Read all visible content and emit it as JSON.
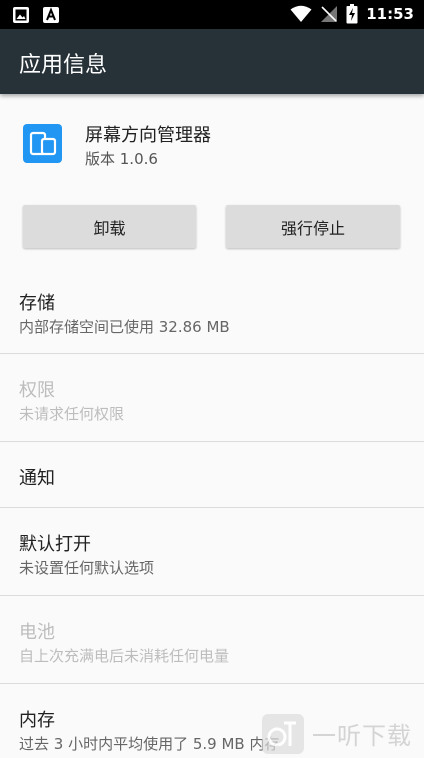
{
  "status_bar": {
    "time": "11:53",
    "left_icons": [
      "image-icon",
      "text-icon"
    ],
    "right_icons": [
      "wifi-icon",
      "signal-off-icon",
      "battery-charging-icon"
    ]
  },
  "app_bar": {
    "title": "应用信息"
  },
  "app": {
    "name": "屏幕方向管理器",
    "version": "版本 1.0.6",
    "icon_color": "#2196f3"
  },
  "buttons": {
    "uninstall": "卸载",
    "force_stop": "强行停止"
  },
  "prefs": [
    {
      "title": "存储",
      "subtitle": "内部存储空间已使用 32.86 MB",
      "enabled": true
    },
    {
      "title": "权限",
      "subtitle": "未请求任何权限",
      "enabled": false
    },
    {
      "title": "通知",
      "enabled": true
    },
    {
      "title": "默认打开",
      "subtitle": "未设置任何默认选项",
      "enabled": true
    },
    {
      "title": "电池",
      "subtitle": "自上次充满电后未消耗任何电量",
      "enabled": false
    },
    {
      "title": "内存",
      "subtitle": "过去 3 小时内平均使用了 5.9 MB 内存",
      "enabled": true
    }
  ],
  "watermark": {
    "text": "一听下载"
  }
}
